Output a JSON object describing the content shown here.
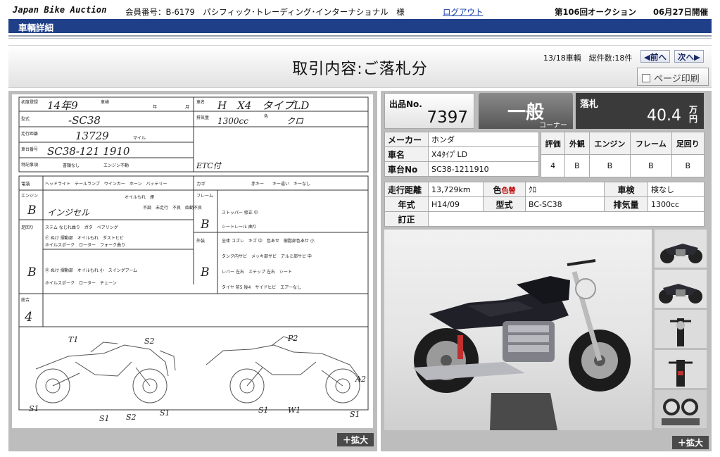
{
  "header": {
    "brand": "Japan Bike Auction",
    "member": "会員番号：B-6179　パシフィック･トレーディング･インターナショナル　様",
    "logout": "ログアウト",
    "auction_no": "第106回オークション",
    "auction_date": "06月27日開催"
  },
  "section_title": "車輌詳細",
  "page": {
    "title": "取引内容:ご落札分",
    "counter": "13/18車輌　総件数:18件",
    "prev": "◀前へ",
    "next": "次へ▶",
    "print": "ページ印刷"
  },
  "sheet": {
    "row1": {
      "reg_label": "初度登録",
      "reg_value": "14年9",
      "shaken_label": "車検",
      "year_unit": "年",
      "month_unit": "月",
      "name_label": "車名",
      "name_value": "H　X4　タイプLD"
    },
    "row2": {
      "type_label": "型式",
      "type_value": "-SC38",
      "cc_label": "排気量",
      "cc_value": "1300cc",
      "color_label": "色",
      "color_value": "クロ"
    },
    "row3": {
      "mileage_label": "走行距離",
      "mileage_value": "13729",
      "mile_note": "マイル"
    },
    "row4": {
      "frame_label": "車台番号",
      "frame_value": "SC38-121 1910"
    },
    "row5": {
      "notes_label": "特記事項",
      "notes_a": "書類なし",
      "notes_b": "エンジン不動",
      "etc": "ETC付"
    },
    "elec_label": "電装",
    "elec_items": "ヘッドライト　テールランプ　ウインカー　ホーン　バッテリー",
    "kagi_label": "カギ",
    "kagi_items": "赤キー　　キー違い　キーなし",
    "engine_label": "エンジン",
    "engine_grade": "B",
    "engine_note": "インジセル",
    "engine_items": "オイルもれ　煙",
    "engine_items2": "不調　未走行　不良　始動不良",
    "frame_sec_label": "フレーム",
    "frame_grade": "B",
    "frame_items": "ストッパー 修正 中",
    "frame_items2": "シートレール 曲り",
    "ashi_label": "足回り",
    "ashi_grade": "B",
    "ashi_items": "ステム なじれ曲り　ガタ　ベアリング",
    "ashi_f": "Ⓕ ぬけ 摺動部　オイルもれ　ダストヒビ",
    "ashi_f2": "ホイルスポーク　ローター　フォーク曲り",
    "ashi_r": "Ⓡ ぬけ 摺動部　オイルもれ 小　スイングアーム",
    "ashi_r2": "ホイルスポーク　ローター　チェーン",
    "gaiso_label": "外装",
    "gaiso_grade": "B",
    "gaiso_items": "全体 コズレ　キズ 中　色あせ　樹脂部色あせ 小",
    "gaiso_items2": "タンク内サビ　メッキ部サビ　アルミ部サビ 中",
    "gaiso_items3": "レバー 左右　ステップ 左右　シート",
    "gaiso_items4": "タイヤ 前5 後4　サイドヒビ　エアーなし",
    "sogo_label": "総合",
    "sogo_value": "4",
    "marks": [
      "T1",
      "S2",
      "S1",
      "S1",
      "S2",
      "S1",
      "P2",
      "A2",
      "S1",
      "W1",
      "S1"
    ]
  },
  "zoom_label": "＋拡大",
  "lot": {
    "label": "出品No.",
    "number": "7397",
    "corner_main": "一般",
    "corner_sub": "コーナー",
    "result_label": "落札",
    "price": "40.4",
    "price_unit": "万円"
  },
  "spec": {
    "maker_label": "メーカー",
    "maker": "ホンダ",
    "name_label": "車名",
    "name": "X4ﾀｲﾌﾟLD",
    "frame_label": "車台No",
    "frame": "SC38-1211910",
    "grade_headers": [
      "評価",
      "外観",
      "エンジン",
      "フレーム",
      "足回り"
    ],
    "grade_values": [
      "4",
      "B",
      "B",
      "B",
      "B"
    ],
    "mileage_label": "走行距離",
    "mileage": "13,729km",
    "color_label": "色",
    "color_tag": "色替",
    "color": "ｸﾛ",
    "shaken_label": "車検",
    "shaken": "検なし",
    "year_label": "年式",
    "year": "H14/09",
    "model_label": "型式",
    "model": "BC-SC38",
    "cc_label": "排気量",
    "cc": "1300cc",
    "correction_label": "訂正",
    "correction": ""
  },
  "colors": {
    "header_blue": "#1f3f88",
    "panel_gray": "#bdbdbd",
    "result_dark": "#3a3a3a",
    "tag_red": "#c00000"
  }
}
